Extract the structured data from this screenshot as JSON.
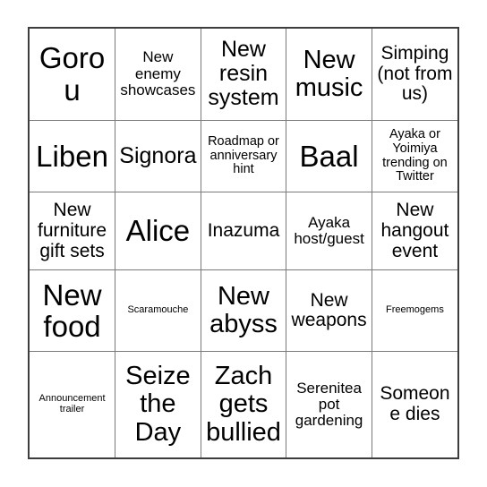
{
  "card": {
    "type": "bingo-card",
    "columns": 5,
    "rows": 5,
    "background_color": "#ffffff",
    "text_color": "#000000",
    "outer_border_color": "#3d3d3d",
    "grid_line_color": "#7a7a7a",
    "cells": [
      [
        {
          "text": "Gorou",
          "size": "fs-xxl"
        },
        {
          "text": "New enemy showcases",
          "size": "fs-sm"
        },
        {
          "text": "New resin system",
          "size": "fs-lg"
        },
        {
          "text": "New music",
          "size": "fs-xl"
        },
        {
          "text": "Simping (not from us)",
          "size": "fs-md"
        }
      ],
      [
        {
          "text": "Liben",
          "size": "fs-xxl"
        },
        {
          "text": "Signora",
          "size": "fs-lg"
        },
        {
          "text": "Roadmap or anniversary hint",
          "size": "fs-xs"
        },
        {
          "text": "Baal",
          "size": "fs-xxl"
        },
        {
          "text": "Ayaka or Yoimiya trending on Twitter",
          "size": "fs-xs"
        }
      ],
      [
        {
          "text": "New furniture gift sets",
          "size": "fs-md"
        },
        {
          "text": "Alice",
          "size": "fs-xxl"
        },
        {
          "text": "Inazuma",
          "size": "fs-md"
        },
        {
          "text": "Ayaka host/guest",
          "size": "fs-sm"
        },
        {
          "text": "New hangout event",
          "size": "fs-md"
        }
      ],
      [
        {
          "text": "New food",
          "size": "fs-xxl"
        },
        {
          "text": "Scaramouche",
          "size": "fs-xxs"
        },
        {
          "text": "New abyss",
          "size": "fs-xl"
        },
        {
          "text": "New weapons",
          "size": "fs-md"
        },
        {
          "text": "Freemogems",
          "size": "fs-xxs"
        }
      ],
      [
        {
          "text": "Announcement trailer",
          "size": "fs-xxs"
        },
        {
          "text": "Seize the Day",
          "size": "fs-xl"
        },
        {
          "text": "Zach gets bullied",
          "size": "fs-xl"
        },
        {
          "text": "Serenitea pot gardening",
          "size": "fs-sm"
        },
        {
          "text": "Someone dies",
          "size": "fs-md"
        }
      ]
    ]
  }
}
